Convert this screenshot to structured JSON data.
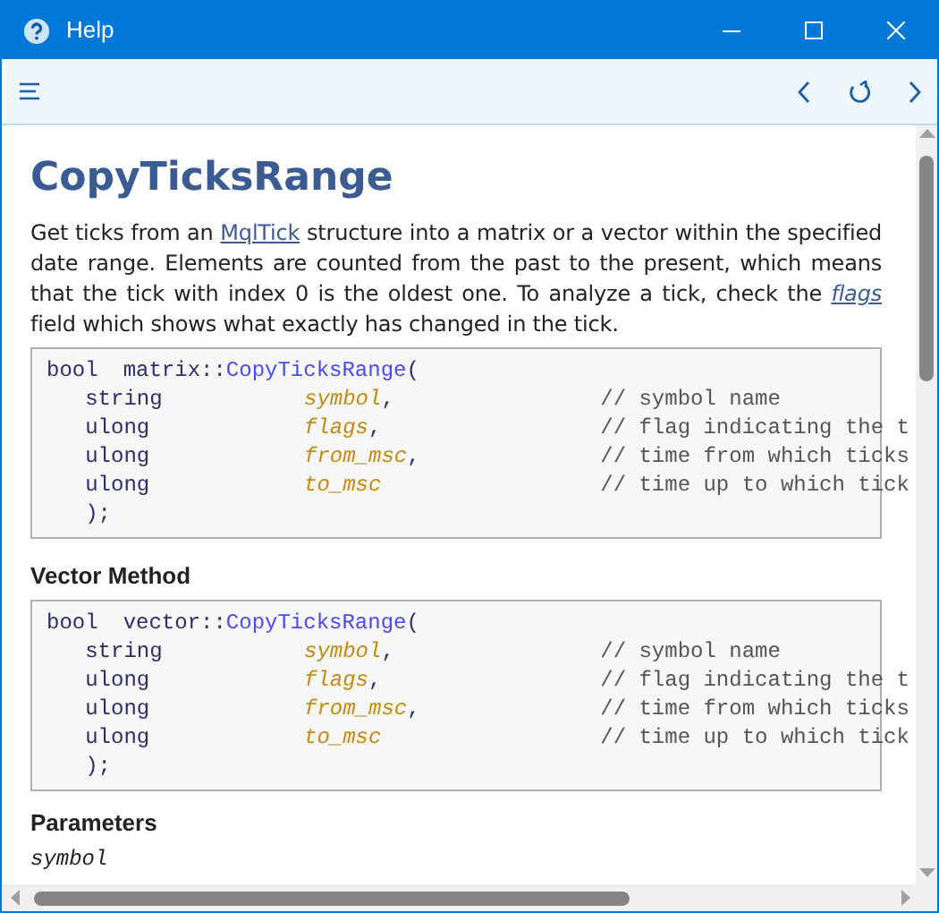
{
  "window": {
    "title": "Help"
  },
  "heading": "CopyTicksRange",
  "description": [
    {
      "text": "Get ticks from an "
    },
    {
      "text": "MqlTick",
      "kind": "link",
      "italic": false
    },
    {
      "text": " structure into a matrix or a vector within the specified date range. Elements are counted from the past to the present, which means that the tick with index 0 is the oldest one. To analyze a tick, check the "
    },
    {
      "text": "flags",
      "kind": "link",
      "italic": true
    },
    {
      "text": " field which shows what exactly has changed in the tick."
    }
  ],
  "sections": [
    {
      "code": {
        "return_type": "bool",
        "scope": "matrix::",
        "function": "CopyTicksRange",
        "open": "(",
        "close": ");",
        "params": [
          {
            "type": "string",
            "name": "symbol",
            "punct": ",",
            "comment": "// symbol name"
          },
          {
            "type": "ulong",
            "name": "flags",
            "punct": ",",
            "comment": "// flag indicating the t"
          },
          {
            "type": "ulong",
            "name": "from_msc",
            "punct": ",",
            "comment": "// time from which ticks"
          },
          {
            "type": "ulong",
            "name": "to_msc",
            "comment": "// time up to which tick"
          }
        ]
      }
    },
    {
      "title": "Vector Method",
      "code": {
        "return_type": "bool",
        "scope": "vector::",
        "function": "CopyTicksRange",
        "open": "(",
        "close": ");",
        "params": [
          {
            "type": "string",
            "name": "symbol",
            "punct": ",",
            "comment": "// symbol name"
          },
          {
            "type": "ulong",
            "name": "flags",
            "punct": ",",
            "comment": "// flag indicating the t"
          },
          {
            "type": "ulong",
            "name": "from_msc",
            "punct": ",",
            "comment": "// time from which ticks"
          },
          {
            "type": "ulong",
            "name": "to_msc",
            "comment": "// time up to which tick"
          }
        ]
      }
    }
  ],
  "parameters": {
    "title": "Parameters",
    "items": [
      "symbol"
    ]
  }
}
